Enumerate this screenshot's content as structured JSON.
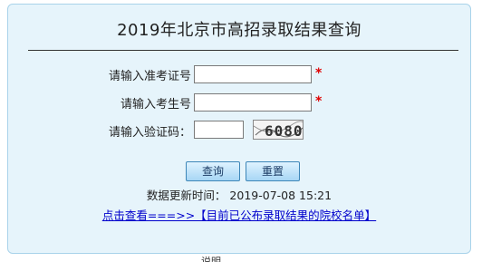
{
  "title": "2019年北京市高招录取结果查询",
  "form": {
    "exam_id_label": "请输入准考证号",
    "exam_id_value": "",
    "student_id_label": "请输入考生号",
    "student_id_value": "",
    "captcha_label": "请输入验证码：",
    "captcha_value": "",
    "captcha_text": "6080",
    "required_mark": "*"
  },
  "buttons": {
    "query": "查询",
    "reset": "重置"
  },
  "update": {
    "label": "数据更新时间：",
    "time": "2019-07-08 15:21"
  },
  "link_text": "点击查看===>>【目前已公布录取结果的院校名单】",
  "footer_partial": "说明"
}
